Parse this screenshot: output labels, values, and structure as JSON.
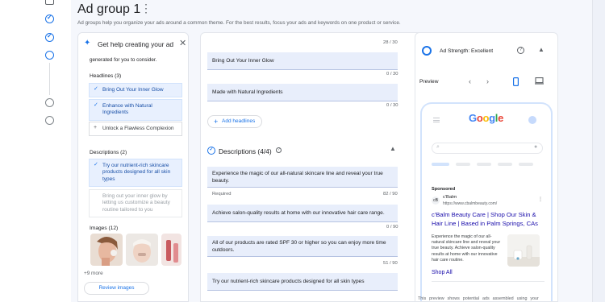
{
  "page": {
    "title": "Ad group 1",
    "more_glyph": "⋮",
    "subtitle": "Ad groups help you organize your ads around a common theme. For the best results, focus your ads and keywords on one product or service."
  },
  "help_panel": {
    "title": "Get help creating your ad",
    "generated_text": "generated for you to consider.",
    "headlines_header": "Headlines (3)",
    "headlines": [
      {
        "text": "Bring Out Your Inner Glow",
        "state": "selected"
      },
      {
        "text": "Enhance with Natural Ingredients",
        "state": "selected"
      },
      {
        "text": "Unlock a Flawless Complexion",
        "state": "available"
      }
    ],
    "descriptions_header": "Descriptions (2)",
    "descriptions": [
      {
        "text": "Try our nutrient-rich skincare products designed for all skin types",
        "state": "selected"
      },
      {
        "text": "Bring out your inner glow by letting us customize a beauty routine tailored to you",
        "state": "faded"
      }
    ],
    "images_header": "Images (12)",
    "more_images": "+9 more",
    "review_button": "Review images"
  },
  "editor": {
    "top_counter": "28 / 30",
    "headlines": [
      {
        "text": "Bring Out Your Inner Glow",
        "counter": "0 / 30"
      },
      {
        "text": "Made with Natural Ingredients",
        "counter": "0 / 30"
      }
    ],
    "add_headlines": "Add headlines",
    "descriptions_title": "Descriptions (4/4)",
    "descriptions": [
      {
        "text": "Experience the magic of our all-natural skincare line and reveal your true beauty.",
        "required": "Required",
        "counter": "82 / 90"
      },
      {
        "text": "Achieve salon-quality results at home with our innovative hair care range.",
        "required": "",
        "counter": "0 / 90"
      },
      {
        "text": "All of our products are rated SPF 30 or higher so you can enjoy more time outdoors.",
        "required": "",
        "counter": "51 / 90"
      },
      {
        "text": "Try our nutrient-rich skincare products designed for all skin types",
        "required": "",
        "counter": ""
      }
    ]
  },
  "preview_panel": {
    "strength": "Ad Strength: Excellent",
    "preview_label": "Preview",
    "google_logo": "Google",
    "sponsored": "Sponsored",
    "brand": "c'Balm",
    "url": "https://www.cbalmbeauty.com/",
    "ad_headline": "c'Balm Beauty Care | Shop Our Skin & Hair Line | Based in Palm Springs, CAs",
    "ad_description": "Experience the magic of our all-natural skincare line and reveal your true beauty. Achieve salon-quality results at home with our innovative hair care routine.",
    "shop_all": "Shop All",
    "footer": "This preview shows potential ads assembled using your"
  },
  "colors": {
    "accent": "#1a73e8",
    "selected_chip": "#e8f0fe",
    "ad_link": "#1a0dab"
  }
}
